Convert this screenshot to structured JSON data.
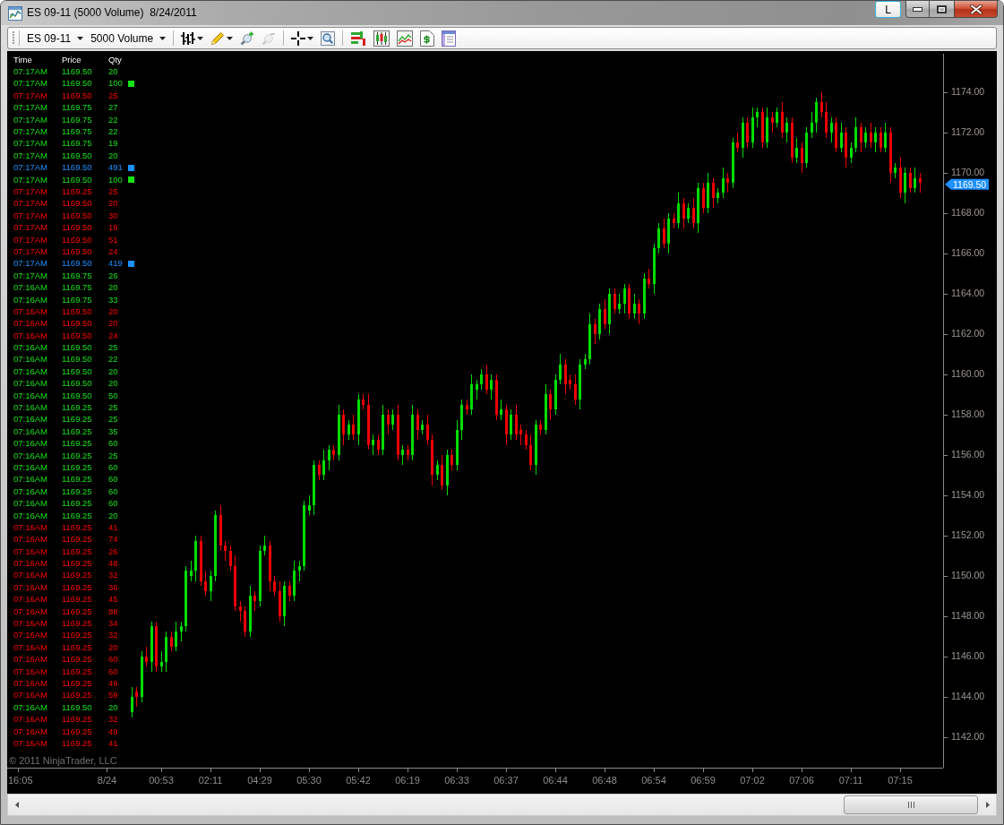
{
  "window": {
    "title": "ES 09-11 (5000 Volume)  8/24/2011",
    "link_button": "L"
  },
  "toolbar": {
    "instrument": "ES 09-11",
    "interval": "5000 Volume",
    "zoom_in": {
      "disabled": false
    },
    "zoom_out": {
      "disabled": true
    }
  },
  "time_and_sales": {
    "columns": [
      "Time",
      "Price",
      "Qty"
    ],
    "rows": [
      {
        "time": "07:17AM",
        "price": "1169.50",
        "qty": "20",
        "color": "#16e316",
        "large": false
      },
      {
        "time": "07:17AM",
        "price": "1169.50",
        "qty": "100",
        "color": "#16e316",
        "large": true
      },
      {
        "time": "07:17AM",
        "price": "1169.50",
        "qty": "25",
        "color": "#ff0000",
        "large": false
      },
      {
        "time": "07:17AM",
        "price": "1169.75",
        "qty": "27",
        "color": "#16e316",
        "large": false
      },
      {
        "time": "07:17AM",
        "price": "1169.75",
        "qty": "22",
        "color": "#16e316",
        "large": false
      },
      {
        "time": "07:17AM",
        "price": "1169.75",
        "qty": "22",
        "color": "#16e316",
        "large": false
      },
      {
        "time": "07:17AM",
        "price": "1169.75",
        "qty": "19",
        "color": "#16e316",
        "large": false
      },
      {
        "time": "07:17AM",
        "price": "1169.50",
        "qty": "20",
        "color": "#16e316",
        "large": false
      },
      {
        "time": "07:17AM",
        "price": "1169.50",
        "qty": "491",
        "color": "#1e90ff",
        "large": true
      },
      {
        "time": "07:17AM",
        "price": "1169.50",
        "qty": "100",
        "color": "#16e316",
        "large": true
      },
      {
        "time": "07:17AM",
        "price": "1169.25",
        "qty": "25",
        "color": "#ff0000",
        "large": false
      },
      {
        "time": "07:17AM",
        "price": "1169.50",
        "qty": "20",
        "color": "#ff0000",
        "large": false
      },
      {
        "time": "07:17AM",
        "price": "1169.50",
        "qty": "30",
        "color": "#ff0000",
        "large": false
      },
      {
        "time": "07:17AM",
        "price": "1169.50",
        "qty": "19",
        "color": "#ff0000",
        "large": false
      },
      {
        "time": "07:17AM",
        "price": "1169.50",
        "qty": "51",
        "color": "#ff0000",
        "large": false
      },
      {
        "time": "07:17AM",
        "price": "1169.50",
        "qty": "24",
        "color": "#ff0000",
        "large": false
      },
      {
        "time": "07:17AM",
        "price": "1169.50",
        "qty": "419",
        "color": "#1e90ff",
        "large": true
      },
      {
        "time": "07:17AM",
        "price": "1169.75",
        "qty": "26",
        "color": "#16e316",
        "large": false
      },
      {
        "time": "07:16AM",
        "price": "1169.75",
        "qty": "20",
        "color": "#16e316",
        "large": false
      },
      {
        "time": "07:16AM",
        "price": "1169.75",
        "qty": "33",
        "color": "#16e316",
        "large": false
      },
      {
        "time": "07:16AM",
        "price": "1169.50",
        "qty": "20",
        "color": "#ff0000",
        "large": false
      },
      {
        "time": "07:16AM",
        "price": "1169.50",
        "qty": "20",
        "color": "#ff0000",
        "large": false
      },
      {
        "time": "07:16AM",
        "price": "1169.50",
        "qty": "24",
        "color": "#ff0000",
        "large": false
      },
      {
        "time": "07:16AM",
        "price": "1169.50",
        "qty": "25",
        "color": "#16e316",
        "large": false
      },
      {
        "time": "07:16AM",
        "price": "1169.50",
        "qty": "22",
        "color": "#16e316",
        "large": false
      },
      {
        "time": "07:16AM",
        "price": "1169.50",
        "qty": "20",
        "color": "#16e316",
        "large": false
      },
      {
        "time": "07:16AM",
        "price": "1169.50",
        "qty": "20",
        "color": "#16e316",
        "large": false
      },
      {
        "time": "07:16AM",
        "price": "1169.50",
        "qty": "50",
        "color": "#16e316",
        "large": false
      },
      {
        "time": "07:16AM",
        "price": "1169.25",
        "qty": "25",
        "color": "#16e316",
        "large": false
      },
      {
        "time": "07:16AM",
        "price": "1169.25",
        "qty": "25",
        "color": "#16e316",
        "large": false
      },
      {
        "time": "07:16AM",
        "price": "1169.25",
        "qty": "35",
        "color": "#16e316",
        "large": false
      },
      {
        "time": "07:16AM",
        "price": "1169.25",
        "qty": "60",
        "color": "#16e316",
        "large": false
      },
      {
        "time": "07:16AM",
        "price": "1169.25",
        "qty": "25",
        "color": "#16e316",
        "large": false
      },
      {
        "time": "07:16AM",
        "price": "1169.25",
        "qty": "60",
        "color": "#16e316",
        "large": false
      },
      {
        "time": "07:16AM",
        "price": "1169.25",
        "qty": "60",
        "color": "#16e316",
        "large": false
      },
      {
        "time": "07:16AM",
        "price": "1169.25",
        "qty": "60",
        "color": "#16e316",
        "large": false
      },
      {
        "time": "07:16AM",
        "price": "1169.25",
        "qty": "60",
        "color": "#16e316",
        "large": false
      },
      {
        "time": "07:16AM",
        "price": "1169.25",
        "qty": "20",
        "color": "#16e316",
        "large": false
      },
      {
        "time": "07:16AM",
        "price": "1169.25",
        "qty": "41",
        "color": "#ff0000",
        "large": false
      },
      {
        "time": "07:16AM",
        "price": "1169.25",
        "qty": "74",
        "color": "#ff0000",
        "large": false
      },
      {
        "time": "07:16AM",
        "price": "1169.25",
        "qty": "26",
        "color": "#ff0000",
        "large": false
      },
      {
        "time": "07:16AM",
        "price": "1169.25",
        "qty": "48",
        "color": "#ff0000",
        "large": false
      },
      {
        "time": "07:16AM",
        "price": "1169.25",
        "qty": "32",
        "color": "#ff0000",
        "large": false
      },
      {
        "time": "07:16AM",
        "price": "1169.25",
        "qty": "36",
        "color": "#ff0000",
        "large": false
      },
      {
        "time": "07:16AM",
        "price": "1169.25",
        "qty": "45",
        "color": "#ff0000",
        "large": false
      },
      {
        "time": "07:16AM",
        "price": "1169.25",
        "qty": "88",
        "color": "#ff0000",
        "large": false
      },
      {
        "time": "07:16AM",
        "price": "1169.25",
        "qty": "34",
        "color": "#ff0000",
        "large": false
      },
      {
        "time": "07:16AM",
        "price": "1169.25",
        "qty": "32",
        "color": "#ff0000",
        "large": false
      },
      {
        "time": "07:16AM",
        "price": "1169.25",
        "qty": "20",
        "color": "#ff0000",
        "large": false
      },
      {
        "time": "07:16AM",
        "price": "1169.25",
        "qty": "60",
        "color": "#ff0000",
        "large": false
      },
      {
        "time": "07:16AM",
        "price": "1169.25",
        "qty": "60",
        "color": "#ff0000",
        "large": false
      },
      {
        "time": "07:16AM",
        "price": "1169.25",
        "qty": "49",
        "color": "#ff0000",
        "large": false
      },
      {
        "time": "07:16AM",
        "price": "1169.25",
        "qty": "59",
        "color": "#ff0000",
        "large": false
      },
      {
        "time": "07:16AM",
        "price": "1169.50",
        "qty": "20",
        "color": "#16e316",
        "large": false
      },
      {
        "time": "07:16AM",
        "price": "1169.25",
        "qty": "32",
        "color": "#ff0000",
        "large": false
      },
      {
        "time": "07:16AM",
        "price": "1169.25",
        "qty": "49",
        "color": "#ff0000",
        "large": false
      },
      {
        "time": "07:16AM",
        "price": "1169.25",
        "qty": "41",
        "color": "#ff0000",
        "large": false
      }
    ]
  },
  "chart": {
    "copyright": "© 2011 NinjaTrader, LLC",
    "chart_data": {
      "type": "candlestick",
      "categories": [
        null,
        null,
        "16:05",
        null,
        null,
        null,
        null,
        null,
        null,
        null,
        null,
        null,
        null,
        null,
        null,
        null,
        null,
        null,
        null,
        null,
        "8/24",
        null,
        null,
        null,
        null,
        null,
        null,
        null,
        null,
        null,
        null,
        "00:53",
        null,
        null,
        null,
        null,
        null,
        null,
        null,
        null,
        null,
        "02:11",
        null,
        null,
        null,
        null,
        null,
        null,
        null,
        null,
        null,
        "04:29",
        null,
        null,
        null,
        null,
        null,
        null,
        null,
        null,
        null,
        "05:30",
        null,
        null,
        null,
        null,
        null,
        null,
        null,
        null,
        null,
        "05:42",
        null,
        null,
        null,
        null,
        null,
        null,
        null,
        null,
        null,
        "06:19",
        null,
        null,
        null,
        null,
        null,
        null,
        null,
        null,
        null,
        "06:33",
        null,
        null,
        null,
        null,
        null,
        null,
        null,
        null,
        null,
        "06:37",
        null,
        null,
        null,
        null,
        null,
        null,
        null,
        null,
        null,
        "06:44",
        null,
        null,
        null,
        null,
        null,
        null,
        null,
        null,
        null,
        "06:48",
        null,
        null,
        null,
        null,
        null,
        null,
        null,
        null,
        null,
        "06:54",
        null,
        null,
        null,
        null,
        null,
        null,
        null,
        null,
        null,
        "06:59",
        null,
        null,
        null,
        null,
        null,
        null,
        null,
        null,
        null,
        "07:02",
        null,
        null,
        null,
        null,
        null,
        null,
        null,
        null,
        null,
        "07:06",
        null,
        null,
        null,
        null,
        null,
        null,
        null,
        null,
        null,
        "07:11",
        null,
        null,
        null,
        null,
        null,
        null,
        null,
        null,
        null,
        "07:15",
        null,
        null,
        null,
        null
      ],
      "ohlc": [
        null,
        null,
        null,
        null,
        null,
        null,
        null,
        null,
        null,
        null,
        null,
        null,
        null,
        null,
        null,
        null,
        null,
        null,
        null,
        null,
        null,
        null,
        null,
        null,
        null,
        [
          1143.25,
          1144.5,
          1143,
          1144
        ],
        [
          1144.25,
          1144.5,
          1143.5,
          1144
        ],
        [
          1144,
          1146.25,
          1143.75,
          1146
        ],
        [
          1146,
          1146.5,
          1145.5,
          1145.75
        ],
        [
          1145.75,
          1147.75,
          1145.25,
          1147.5
        ],
        [
          1147.5,
          1147.75,
          1145.25,
          1145.5
        ],
        [
          1145.5,
          1146.25,
          1145.25,
          1145.75
        ],
        [
          1145.75,
          1147.25,
          1145.25,
          1147
        ],
        [
          1147,
          1147.25,
          1146.25,
          1146.5
        ],
        [
          1146.5,
          1147.75,
          1146.25,
          1147.25
        ],
        [
          1147.25,
          1147.75,
          1146.75,
          1147.5
        ],
        [
          1147.5,
          1150.5,
          1147.25,
          1150.25
        ],
        [
          1150,
          1150.75,
          1149.75,
          1150.25
        ],
        [
          1150.25,
          1152,
          1149.75,
          1151.75
        ],
        [
          1151.75,
          1152,
          1149.5,
          1149.75
        ],
        [
          1149.75,
          1150.25,
          1149,
          1149.25
        ],
        [
          1149.25,
          1150.25,
          1148.75,
          1150
        ],
        [
          1150,
          1153.25,
          1149.75,
          1153
        ],
        [
          1153,
          1153.5,
          1151.25,
          1151.5
        ],
        [
          1151.5,
          1151.75,
          1150.75,
          1151.25
        ],
        [
          1151.25,
          1151.5,
          1150.25,
          1150.5
        ],
        [
          1150.5,
          1151,
          1148.25,
          1148.5
        ],
        [
          1148.5,
          1148.75,
          1147.75,
          1148.25
        ],
        [
          1148.25,
          1148.5,
          1147,
          1147.25
        ],
        [
          1147.25,
          1149.5,
          1147,
          1149
        ],
        [
          1149,
          1149.25,
          1148.25,
          1148.75
        ],
        [
          1148.75,
          1151.5,
          1148.5,
          1151.25
        ],
        [
          1151.25,
          1152,
          1151,
          1151.5
        ],
        [
          1151.5,
          1151.75,
          1149.25,
          1149.75
        ],
        [
          1149.75,
          1150,
          1149,
          1149.25
        ],
        [
          1149.25,
          1149.75,
          1147.75,
          1148
        ],
        [
          1148,
          1149.75,
          1147.5,
          1149.5
        ],
        [
          1149.5,
          1149.75,
          1148.75,
          1149
        ],
        [
          1149,
          1150.75,
          1148.75,
          1150.25
        ],
        [
          1150.25,
          1150.75,
          1149.75,
          1150.5
        ],
        [
          1150.5,
          1153.75,
          1150.25,
          1153.5
        ],
        [
          1153.25,
          1154,
          1153,
          1153.5
        ],
        [
          1153.5,
          1155.75,
          1153,
          1155.5
        ],
        [
          1155.5,
          1155.75,
          1154.75,
          1155
        ],
        [
          1155,
          1156.25,
          1154.75,
          1155.75
        ],
        [
          1155.75,
          1156.5,
          1155.25,
          1156.25
        ],
        [
          1156.25,
          1156.5,
          1155.75,
          1156
        ],
        [
          1156,
          1158.5,
          1155.75,
          1158
        ],
        [
          1158,
          1158.25,
          1156.5,
          1157
        ],
        [
          1157,
          1157.75,
          1156.75,
          1157.5
        ],
        [
          1157.5,
          1158,
          1156.75,
          1157
        ],
        [
          1157,
          1159,
          1156.5,
          1158.75
        ],
        [
          1158.75,
          1159,
          1158.25,
          1158.5
        ],
        [
          1158.5,
          1159,
          1156.25,
          1156.5
        ],
        [
          1156.5,
          1157,
          1156,
          1156.75
        ],
        [
          1156.75,
          1157,
          1156,
          1156.25
        ],
        [
          1156.25,
          1158.5,
          1156,
          1158
        ],
        [
          1158,
          1158.25,
          1157,
          1157.5
        ],
        [
          1157.5,
          1158.25,
          1157.25,
          1158
        ],
        [
          1158,
          1158.5,
          1155.75,
          1156
        ],
        [
          1156,
          1156.5,
          1155.5,
          1156.25
        ],
        [
          1156.25,
          1156.5,
          1155.75,
          1156
        ],
        [
          1156,
          1158.5,
          1155.75,
          1158
        ],
        [
          1158,
          1158.25,
          1156.75,
          1157.25
        ],
        [
          1157.25,
          1157.75,
          1157,
          1157.5
        ],
        [
          1157.5,
          1158,
          1156.5,
          1156.75
        ],
        [
          1156.75,
          1157,
          1154.5,
          1155
        ],
        [
          1155,
          1155.75,
          1154.75,
          1155.5
        ],
        [
          1155.5,
          1156,
          1154.25,
          1154.5
        ],
        [
          1154.5,
          1156.25,
          1154,
          1156
        ],
        [
          1156,
          1156.25,
          1155.25,
          1155.5
        ],
        [
          1155.5,
          1157.75,
          1155.25,
          1157.25
        ],
        [
          1157.25,
          1158.75,
          1156.75,
          1158.5
        ],
        [
          1158.5,
          1158.75,
          1158,
          1158.25
        ],
        [
          1158.25,
          1160,
          1158,
          1159.5
        ],
        [
          1159.25,
          1159.75,
          1158.75,
          1159.5
        ],
        [
          1159.5,
          1160.25,
          1159.25,
          1160
        ],
        [
          1160,
          1160.5,
          1159,
          1159.25
        ],
        [
          1159.25,
          1160,
          1158.75,
          1159.75
        ],
        [
          1159.75,
          1160,
          1157.75,
          1158
        ],
        [
          1158,
          1158.75,
          1157.75,
          1158.25
        ],
        [
          1158.25,
          1158.5,
          1156.5,
          1157
        ],
        [
          1157,
          1158.25,
          1156.75,
          1158
        ],
        [
          1158,
          1158.5,
          1156.75,
          1157
        ],
        [
          1157.25,
          1157.5,
          1156.5,
          1157
        ],
        [
          1157,
          1157.25,
          1156.25,
          1156.5
        ],
        [
          1156.5,
          1157,
          1155.25,
          1155.5
        ],
        [
          1155.5,
          1157.75,
          1155,
          1157.5
        ],
        [
          1157.5,
          1157.75,
          1157,
          1157.25
        ],
        [
          1157.25,
          1159.5,
          1157,
          1159
        ],
        [
          1159,
          1159.25,
          1157.75,
          1158.25
        ],
        [
          1158.25,
          1160,
          1158,
          1159.75
        ],
        [
          1159.75,
          1161,
          1159.5,
          1160.5
        ],
        [
          1160.5,
          1160.75,
          1159,
          1159.5
        ],
        [
          1159.75,
          1160,
          1159.25,
          1159.5
        ],
        [
          1159.5,
          1160,
          1158.5,
          1158.75
        ],
        [
          1158.75,
          1160.75,
          1158.25,
          1160.5
        ],
        [
          1160.5,
          1161,
          1160.25,
          1160.75
        ],
        [
          1160.75,
          1163,
          1160.5,
          1162.5
        ],
        [
          1162.5,
          1162.75,
          1161.5,
          1162
        ],
        [
          1162,
          1163.5,
          1161.75,
          1163.25
        ],
        [
          1163.25,
          1163.75,
          1162.25,
          1162.5
        ],
        [
          1162.5,
          1164.25,
          1162,
          1164
        ],
        [
          1164,
          1164.25,
          1163,
          1163.25
        ],
        [
          1163.25,
          1164,
          1163,
          1163.5
        ],
        [
          1163.5,
          1164.5,
          1163,
          1164.25
        ],
        [
          1164.25,
          1164.5,
          1162.75,
          1163
        ],
        [
          1163,
          1164,
          1162.75,
          1163.5
        ],
        [
          1163.5,
          1163.75,
          1162.5,
          1163
        ],
        [
          1163,
          1165,
          1162.75,
          1164.75
        ],
        [
          1164.75,
          1165.25,
          1164.25,
          1164.5
        ],
        [
          1164.5,
          1166.5,
          1164,
          1166.25
        ],
        [
          1166.25,
          1167.5,
          1166,
          1167.25
        ],
        [
          1167.25,
          1167.75,
          1166.25,
          1166.5
        ],
        [
          1166.5,
          1168,
          1166,
          1167.75
        ],
        [
          1167.75,
          1168,
          1167.25,
          1167.5
        ],
        [
          1167.5,
          1169,
          1167.25,
          1168.5
        ],
        [
          1168.5,
          1168.75,
          1167.25,
          1167.75
        ],
        [
          1167.75,
          1168.5,
          1167.5,
          1168.25
        ],
        [
          1168.25,
          1168.75,
          1167.25,
          1167.5
        ],
        [
          1167.5,
          1169.5,
          1167,
          1169.25
        ],
        [
          1169.25,
          1169.5,
          1168,
          1168.25
        ],
        [
          1168.25,
          1170,
          1168,
          1169.5
        ],
        [
          1169.5,
          1169.75,
          1168.25,
          1168.75
        ],
        [
          1168.75,
          1169.25,
          1168.5,
          1169
        ],
        [
          1169,
          1170.25,
          1168.75,
          1169.75
        ],
        [
          1169.75,
          1170,
          1169,
          1169.5
        ],
        [
          1169.5,
          1171.75,
          1169.25,
          1171.5
        ],
        [
          1171.5,
          1172,
          1171,
          1171.25
        ],
        [
          1171.25,
          1172.75,
          1170.75,
          1172.5
        ],
        [
          1172.5,
          1172.75,
          1171.25,
          1171.5
        ],
        [
          1171.5,
          1173.25,
          1171.25,
          1172.75
        ],
        [
          1172.75,
          1173.25,
          1172.25,
          1173
        ],
        [
          1173,
          1173.25,
          1171.25,
          1171.5
        ],
        [
          1171.5,
          1173.25,
          1171.25,
          1172.75
        ],
        [
          1172.75,
          1173,
          1172,
          1172.5
        ],
        [
          1172.5,
          1173.25,
          1172.25,
          1173
        ],
        [
          1173,
          1173.5,
          1171.75,
          1172
        ],
        [
          1172,
          1172.75,
          1171.5,
          1172.5
        ],
        [
          1172.5,
          1172.75,
          1170.5,
          1170.75
        ],
        [
          1170.75,
          1171.75,
          1170.5,
          1171.25
        ],
        [
          1171.25,
          1171.5,
          1170,
          1170.5
        ],
        [
          1170.5,
          1172.25,
          1170.25,
          1172
        ],
        [
          1172,
          1173,
          1171.75,
          1172.5
        ],
        [
          1172.5,
          1173.75,
          1172,
          1173.5
        ],
        [
          1173.5,
          1174,
          1172.75,
          1173
        ],
        [
          1173,
          1173.5,
          1171.75,
          1172
        ],
        [
          1172,
          1172.75,
          1171.5,
          1172.5
        ],
        [
          1172.5,
          1172.75,
          1171,
          1171.25
        ],
        [
          1171.25,
          1172.5,
          1171,
          1172
        ],
        [
          1172,
          1172.25,
          1170.25,
          1170.75
        ],
        [
          1170.75,
          1171.5,
          1170.5,
          1171.25
        ],
        [
          1171.25,
          1172.75,
          1171,
          1172.25
        ],
        [
          1172.25,
          1172.5,
          1171,
          1171.5
        ],
        [
          1171.5,
          1172.25,
          1171.25,
          1172
        ],
        [
          1172,
          1172.5,
          1171.25,
          1171.5
        ],
        [
          1171.5,
          1172.25,
          1171,
          1172
        ],
        [
          1172,
          1172.25,
          1171,
          1171.25
        ],
        [
          1171.25,
          1172.5,
          1171,
          1172
        ],
        [
          1172,
          1172.25,
          1169.5,
          1170
        ],
        [
          1170,
          1170.5,
          1169.75,
          1170.25
        ],
        [
          1170.25,
          1170.75,
          1168.75,
          1169
        ],
        [
          1169,
          1170.25,
          1168.5,
          1170
        ],
        [
          1170,
          1170.25,
          1169,
          1169.25
        ],
        [
          1169.25,
          1170.25,
          1169,
          1169.75
        ],
        [
          1169.75,
          1170,
          1169,
          1169.5
        ]
      ],
      "ylim": [
        1140.49,
        1176.04
      ],
      "yticks": [
        {
          "value": 1174,
          "label": "1174.00"
        },
        {
          "value": 1172,
          "label": "1172.00"
        },
        {
          "value": 1170,
          "label": "1170.00"
        },
        {
          "value": 1168,
          "label": "1168.00"
        },
        {
          "value": 1166,
          "label": "1166.00"
        },
        {
          "value": 1164,
          "label": "1164.00"
        },
        {
          "value": 1162,
          "label": "1162.00"
        },
        {
          "value": 1160,
          "label": "1160.00"
        },
        {
          "value": 1158,
          "label": "1158.00"
        },
        {
          "value": 1156,
          "label": "1156.00"
        },
        {
          "value": 1154,
          "label": "1154.00"
        },
        {
          "value": 1152,
          "label": "1152.00"
        },
        {
          "value": 1150,
          "label": "1150.00"
        },
        {
          "value": 1148,
          "label": "1148.00"
        },
        {
          "value": 1146,
          "label": "1146.00"
        },
        {
          "value": 1144,
          "label": "1144.00"
        },
        {
          "value": 1142,
          "label": "1142.00"
        }
      ],
      "annotations": [
        "1169.50"
      ]
    }
  }
}
